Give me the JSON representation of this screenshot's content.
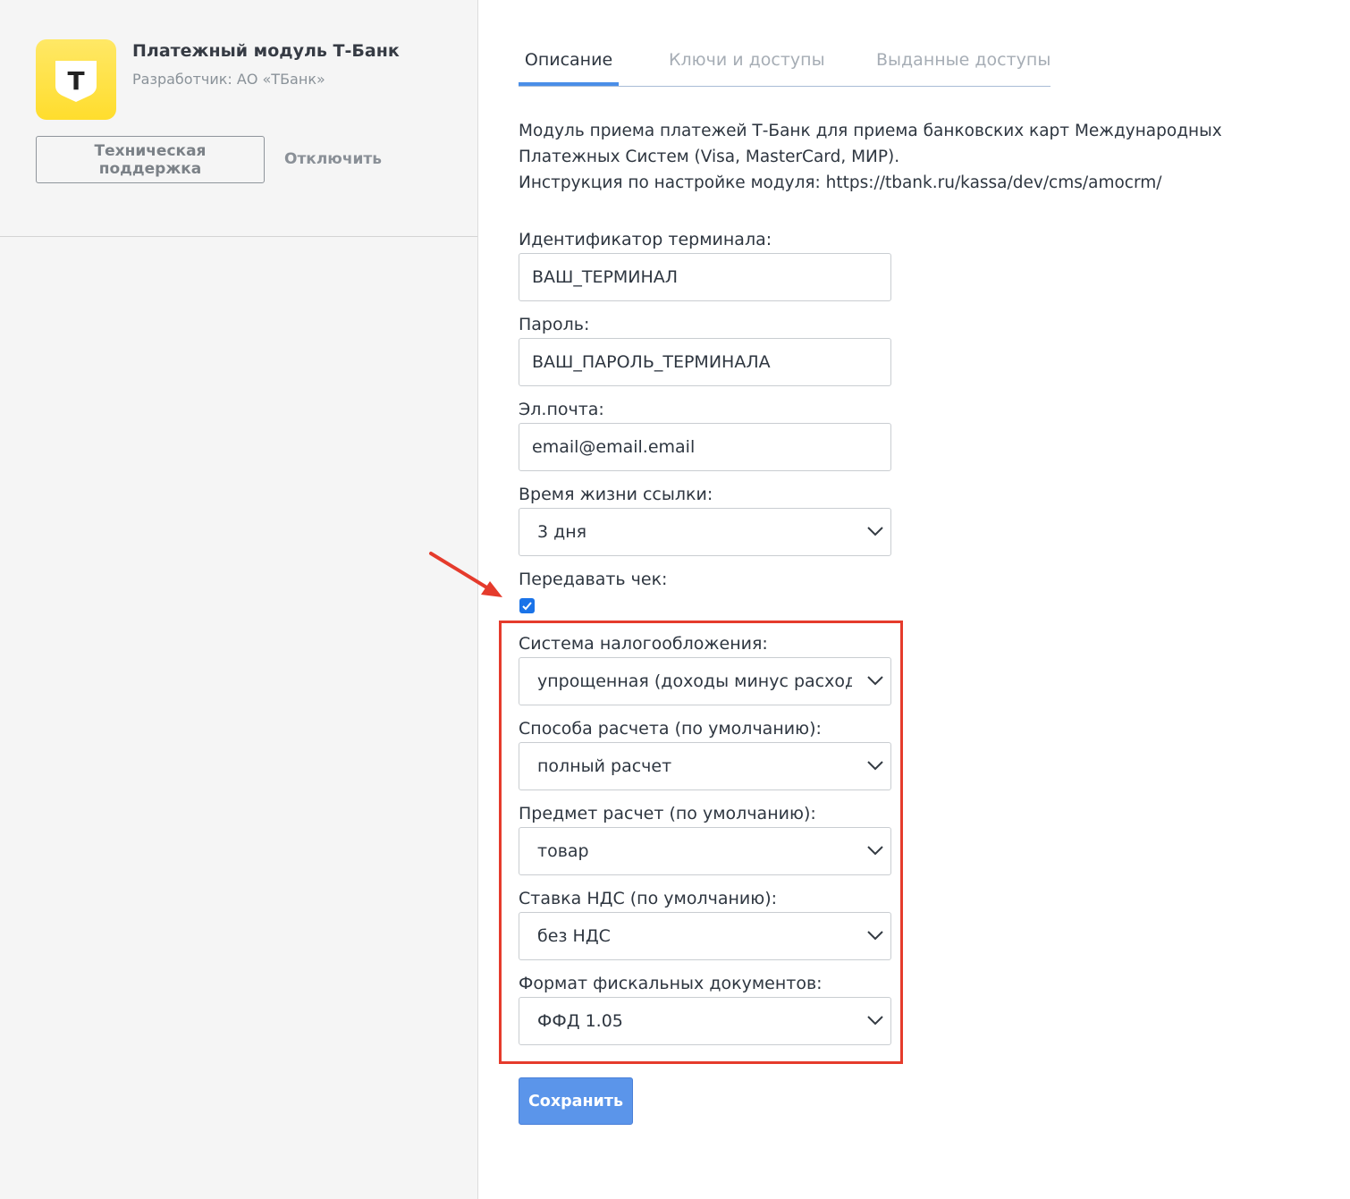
{
  "app": {
    "title": "Платежный модуль Т-Банк",
    "developer": "Разработчик: АО «ТБанк»",
    "logo_letter": "T",
    "support_button": "Техническая поддержка",
    "disable_link": "Отключить"
  },
  "tabs": [
    {
      "label": "Описание",
      "active": true
    },
    {
      "label": "Ключи и доступы",
      "active": false
    },
    {
      "label": "Выданные доступы",
      "active": false
    }
  ],
  "description": {
    "line1": "Модуль приема платежей Т-Банк для приема банковских карт Международных",
    "line2": "Платежных Систем (Visa, MasterCard, МИР).",
    "line3": "Инструкция по настройке модуля: https://tbank.ru/kassa/dev/cms/amocrm/"
  },
  "form": {
    "terminal_id": {
      "label": "Идентификатор терминала:",
      "value": "ВАШ_ТЕРМИНАЛ"
    },
    "password": {
      "label": "Пароль:",
      "value": "ВАШ_ПАРОЛЬ_ТЕРМИНАЛА"
    },
    "email": {
      "label": "Эл.почта:",
      "value": "email@email.email"
    },
    "link_lifetime": {
      "label": "Время жизни ссылки:",
      "value": "3 дня"
    },
    "send_receipt": {
      "label": "Передавать чек:",
      "checked": true
    },
    "tax_system": {
      "label": "Система налогообложения:",
      "value": "упрощенная (доходы минус расходы)"
    },
    "payment_method": {
      "label": "Способа расчета (по умолчанию):",
      "value": "полный расчет"
    },
    "payment_object": {
      "label": "Предмет расчет (по умолчанию):",
      "value": "товар"
    },
    "vat_rate": {
      "label": "Ставка НДС (по умолчанию):",
      "value": "без НДС"
    },
    "ffd_format": {
      "label": "Формат фискальных документов:",
      "value": "ФФД 1.05"
    },
    "save_button": "Сохранить"
  },
  "colors": {
    "accent": "#4a8ee8",
    "button": "#5b95ea",
    "highlight": "#e53b2c",
    "logo_yellow": "#ffdd2d"
  },
  "icons": {
    "logo": "tbank-shield-icon",
    "select": "chevron-down-icon",
    "checkbox": "check-icon",
    "annotation": "arrow-icon"
  }
}
